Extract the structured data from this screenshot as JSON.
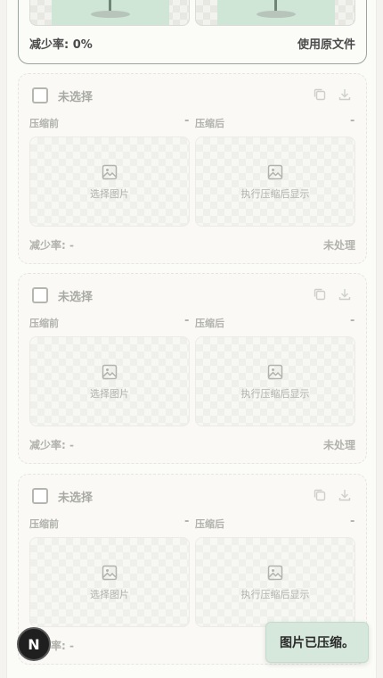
{
  "active_card": {
    "reduction_label": "减少率: 0%",
    "use_original_label": "使用原文件"
  },
  "slots": [
    {
      "select_label": "未选择",
      "before_label": "压缩前",
      "before_value": "-",
      "after_label": "压缩后",
      "after_value": "-",
      "select_image_text": "选择图片",
      "after_placeholder_text": "执行压缩后显示",
      "reduction_label": "减少率: -",
      "status_text": "未处理"
    },
    {
      "select_label": "未选择",
      "before_label": "压缩前",
      "before_value": "-",
      "after_label": "压缩后",
      "after_value": "-",
      "select_image_text": "选择图片",
      "after_placeholder_text": "执行压缩后显示",
      "reduction_label": "减少率: -",
      "status_text": "未处理"
    },
    {
      "select_label": "未选择",
      "before_label": "压缩前",
      "before_value": "-",
      "after_label": "压缩后",
      "after_value": "-",
      "select_image_text": "选择图片",
      "after_placeholder_text": "执行压缩后显示",
      "reduction_label": "减少率: -",
      "status_text": ""
    }
  ],
  "fab": {
    "letter": "N"
  },
  "toast": {
    "message": "图片已压缩。"
  },
  "colors": {
    "accent_green": "#d6e8dc",
    "card_border": "#9aa69b",
    "fab_bg": "#1f1f1f"
  }
}
